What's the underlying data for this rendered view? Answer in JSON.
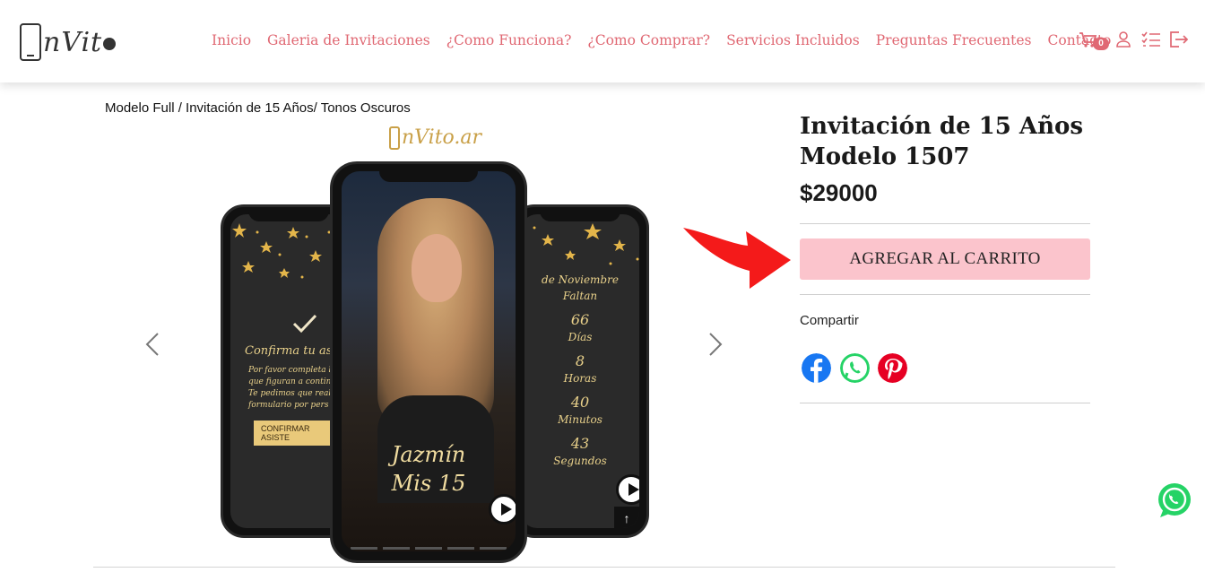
{
  "header": {
    "logo_text": "nVit",
    "nav": [
      "Inicio",
      "Galeria de Invitaciones",
      "¿Como Funciona?",
      "¿Como Comprar?",
      "Servicios Incluidos",
      "Preguntas Frecuentes",
      "Contacto"
    ],
    "cart_count": "0",
    "accent_color": "#e06873"
  },
  "breadcrumb": "Modelo Full / Invitación de 15 Años/ Tonos Oscuros",
  "gallery": {
    "watermark": "nVito.ar",
    "left_screen": {
      "title": "Confirma tu asis",
      "lines": [
        "Por favor completa lo",
        "que figuran a contin",
        "Te pedimos que reali",
        "formulario por pers"
      ],
      "button": "CONFIRMAR ASISTE"
    },
    "center_screen": {
      "name": "Jazmín",
      "subtitle": "Mis 15"
    },
    "right_screen": {
      "month": "de Noviembre",
      "falta": "Faltan",
      "countdown": [
        {
          "value": "66",
          "unit": "Días"
        },
        {
          "value": "8",
          "unit": "Horas"
        },
        {
          "value": "40",
          "unit": "Minutos"
        },
        {
          "value": "43",
          "unit": "Segundos"
        }
      ]
    }
  },
  "product": {
    "title": "Invitación de 15 Años Modelo 1507",
    "price": "$29000",
    "cart_button": "AGREGAR AL CARRITO",
    "cart_button_color": "#fbc4cc",
    "share_label": "Compartir"
  },
  "social_colors": {
    "facebook": "#1877f2",
    "whatsapp": "#25d366",
    "pinterest": "#e60023"
  }
}
